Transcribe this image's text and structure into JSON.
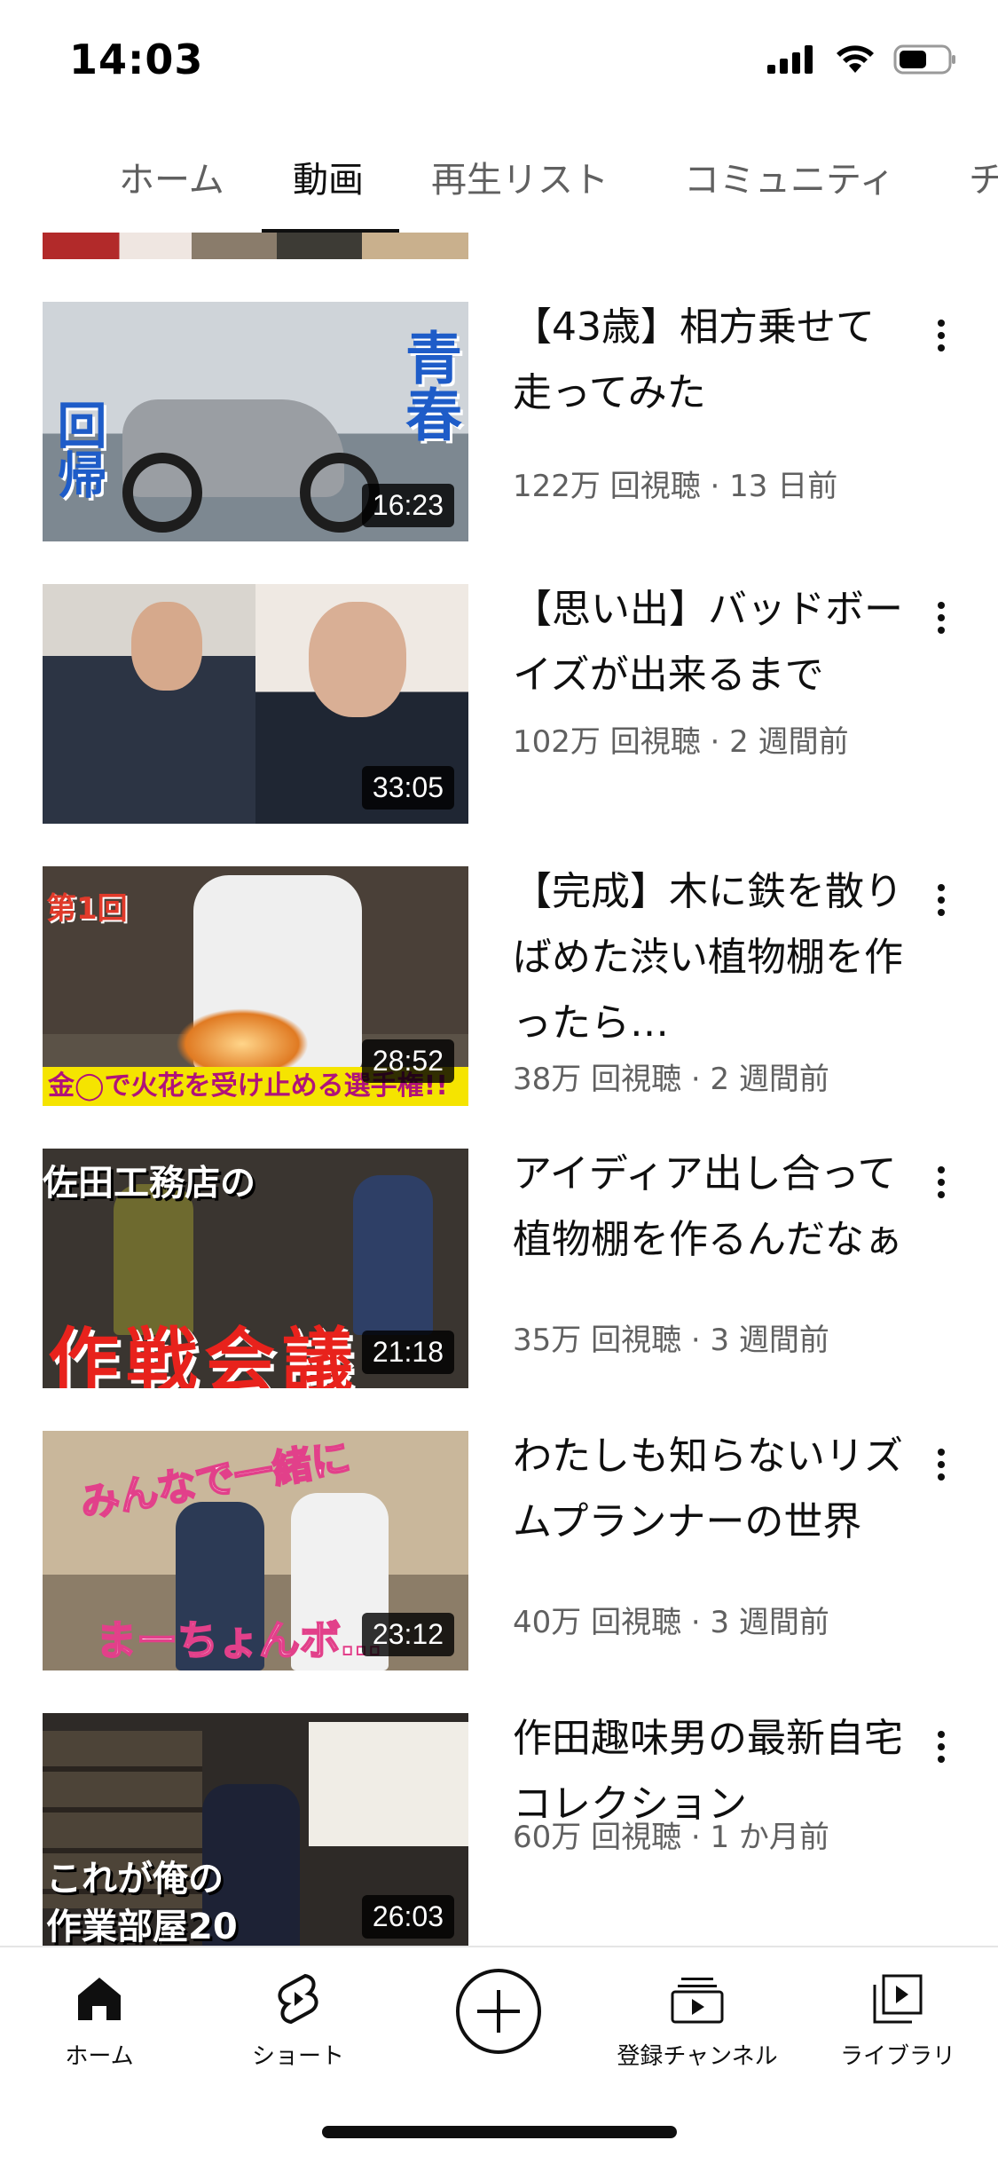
{
  "status_bar": {
    "time": "14:03"
  },
  "tabs": [
    {
      "label": "ホーム"
    },
    {
      "label": "動画"
    },
    {
      "label": "再生リスト"
    },
    {
      "label": "コミュニティ"
    },
    {
      "label": "チ"
    }
  ],
  "active_tab": "動画",
  "videos": [
    {
      "title": "【43歳】相方乗せて走ってみた",
      "meta": "122万 回視聴 · 13 日前",
      "duration": "16:23",
      "thumb_text": [
        "青春",
        "回帰"
      ]
    },
    {
      "title": "【思い出】バッドボーイズが出来るまで",
      "meta": "102万 回視聴 · 2 週間前",
      "duration": "33:05"
    },
    {
      "title": "【完成】木に鉄を散りばめた渋い植物棚を作ったら…",
      "meta": "38万 回視聴 · 2 週間前",
      "duration": "28:52",
      "thumb_text": [
        "第1回",
        "金◯で火花を受け止める選手権!!"
      ]
    },
    {
      "title": "アイディア出し合って植物棚を作るんだなぁ",
      "meta": "35万 回視聴 · 3 週間前",
      "duration": "21:18",
      "thumb_text": [
        "佐田工務店の",
        "作戦会議"
      ]
    },
    {
      "title": "わたしも知らないリズムプランナーの世界",
      "meta": "40万 回視聴 · 3 週間前",
      "duration": "23:12",
      "thumb_text": [
        "みんなで一緒に",
        "まーちょんボ…"
      ]
    },
    {
      "title": "作田趣味男の最新自宅コレクション",
      "meta": "60万 回視聴 · 1 か月前",
      "duration": "26:03",
      "thumb_text": [
        "これが俺の",
        "作業部屋20"
      ]
    }
  ],
  "bottom_nav": [
    {
      "label": "ホーム",
      "icon": "home-icon"
    },
    {
      "label": "ショート",
      "icon": "shorts-icon"
    },
    {
      "label": "",
      "icon": "create-icon"
    },
    {
      "label": "登録チャンネル",
      "icon": "subscriptions-icon"
    },
    {
      "label": "ライブラリ",
      "icon": "library-icon"
    }
  ]
}
